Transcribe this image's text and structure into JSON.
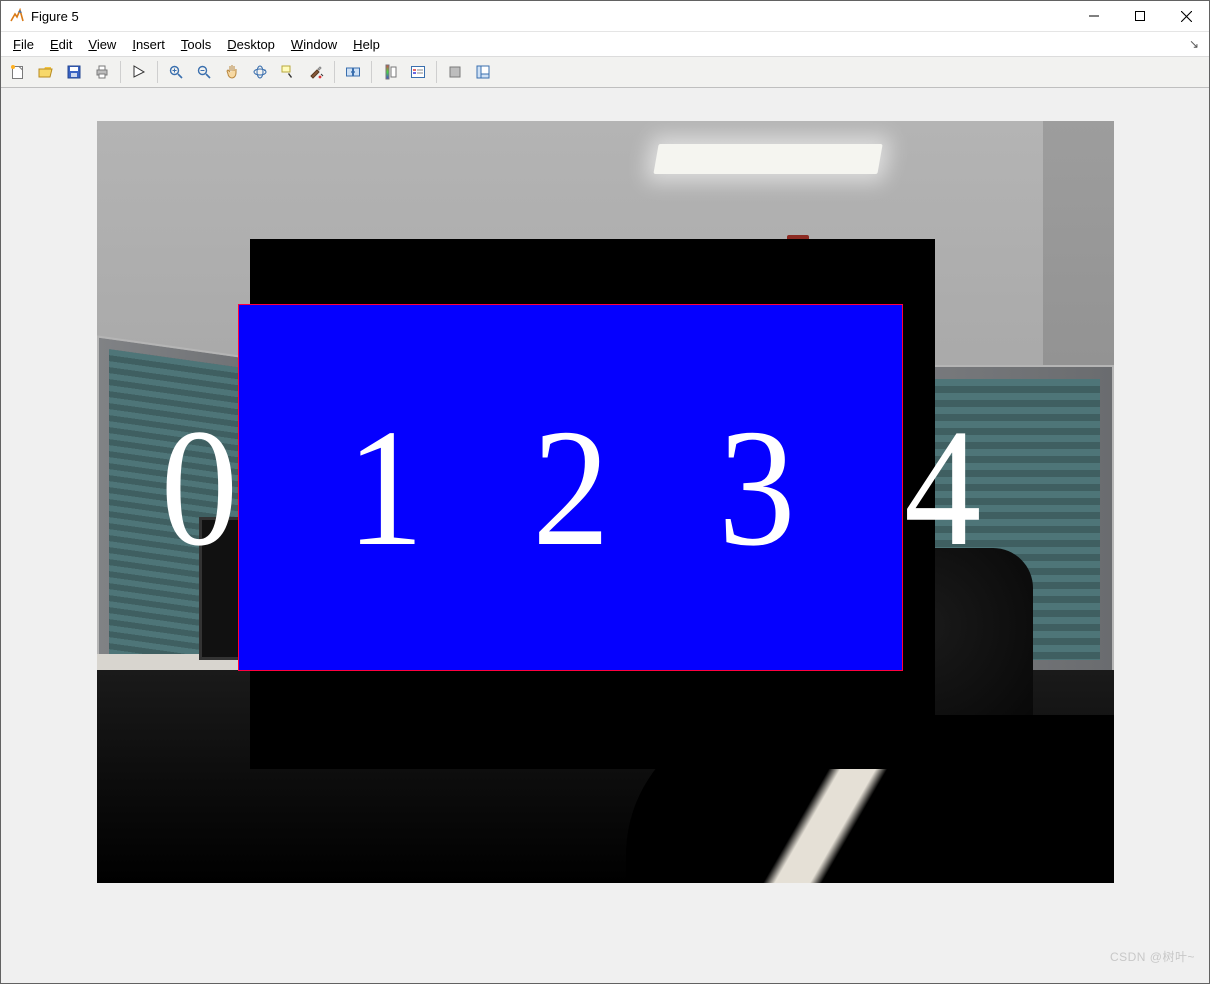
{
  "window": {
    "title": "Figure 5"
  },
  "menus": {
    "file": "File",
    "edit": "Edit",
    "view": "View",
    "insert": "Insert",
    "tools": "Tools",
    "desktop": "Desktop",
    "window": "Window",
    "help": "Help"
  },
  "overlay": {
    "digits": "0 1 2 3 4"
  },
  "watermark": "CSDN @树叶~"
}
